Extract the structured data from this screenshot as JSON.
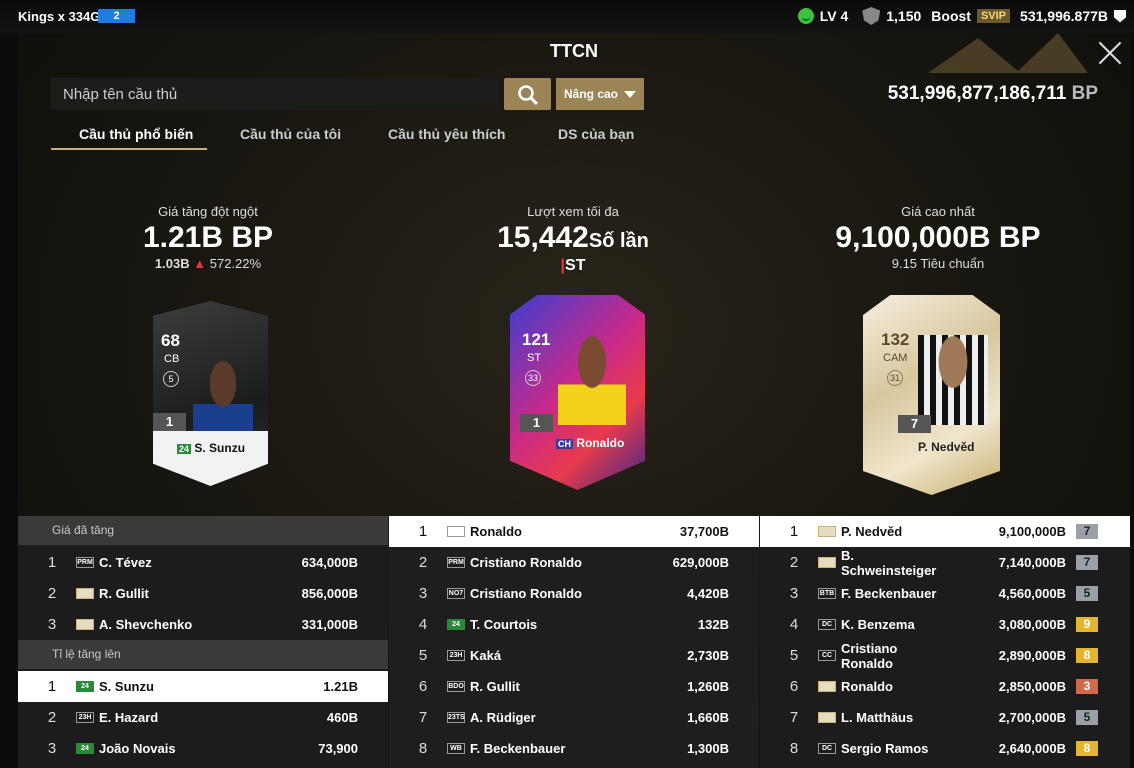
{
  "topbar": {
    "user": "Kings x 334G",
    "badge": "2",
    "level": "LV 4",
    "shield": "1,150",
    "boost": "Boost",
    "svip": "SVIP",
    "bp": "531,996.877B"
  },
  "title": "TTCN",
  "search": {
    "placeholder": "Nhập tên cầu thủ",
    "advanced": "Nâng cao"
  },
  "balance": {
    "value": "531,996,877,186,711",
    "unit": "BP"
  },
  "tabs": [
    "Cầu thủ phổ biến",
    "Cầu thủ của tôi",
    "Cầu thủ yêu thích",
    "DS của bạn"
  ],
  "featured": [
    {
      "label": "Giá tăng đột ngột",
      "big": "1.21B BP",
      "sub_a": "1.03B",
      "sub_b": "572.22%",
      "card": {
        "ovr": "68",
        "pos": "CB",
        "tier": "5",
        "lvl": "1",
        "season": "24",
        "name": "S. Sunzu"
      }
    },
    {
      "label": "Lượt xem tối đa",
      "big": "15,442",
      "big_unit": "Số lần",
      "pos": "ST",
      "card": {
        "ovr": "121",
        "pos": "ST",
        "tier": "33",
        "lvl": "1",
        "season": "CH",
        "name": "Ronaldo"
      }
    },
    {
      "label": "Giá cao nhất",
      "big": "9,100,000B BP",
      "sub": "9.15 Tiêu chuẩn",
      "card": {
        "ovr": "132",
        "pos": "CAM",
        "tier": "31",
        "lvl": "7",
        "season": "",
        "name": "P. Nedvěd"
      }
    }
  ],
  "left": {
    "header1": "Giá đã tăng",
    "rows1": [
      {
        "rank": "1",
        "season": "PRM",
        "name": "C. Tévez",
        "value": "634,000B"
      },
      {
        "rank": "2",
        "season": "",
        "name": "R. Gullit",
        "value": "856,000B"
      },
      {
        "rank": "3",
        "season": "",
        "name": "A. Shevchenko",
        "value": "331,000B"
      }
    ],
    "header2": "Tỉ lệ tăng lên",
    "rows2": [
      {
        "rank": "1",
        "season": "24",
        "name": "S. Sunzu",
        "value": "1.21B"
      },
      {
        "rank": "2",
        "season": "23H",
        "name": "E. Hazard",
        "value": "460B"
      },
      {
        "rank": "3",
        "season": "24",
        "name": "João Novais",
        "value": "73,900"
      }
    ]
  },
  "middle": [
    {
      "rank": "1",
      "season": "CH",
      "name": "Ronaldo",
      "value": "37,700B"
    },
    {
      "rank": "2",
      "season": "PRM",
      "name": "Cristiano Ronaldo",
      "value": "629,000B"
    },
    {
      "rank": "3",
      "season": "NO7",
      "name": "Cristiano Ronaldo",
      "value": "4,420B"
    },
    {
      "rank": "4",
      "season": "24",
      "name": "T. Courtois",
      "value": "132B"
    },
    {
      "rank": "5",
      "season": "23H",
      "name": "Kaká",
      "value": "2,730B"
    },
    {
      "rank": "6",
      "season": "BDO",
      "name": "R. Gullit",
      "value": "1,260B"
    },
    {
      "rank": "7",
      "season": "23TS",
      "name": "A. Rüdiger",
      "value": "1,660B"
    },
    {
      "rank": "8",
      "season": "WB",
      "name": "F. Beckenbauer",
      "value": "1,300B"
    }
  ],
  "right": [
    {
      "rank": "1",
      "season": "",
      "name": "P. Nedvěd",
      "value": "9,100,000B",
      "lvl": "7"
    },
    {
      "rank": "2",
      "season": "",
      "name": "B. Schweinsteiger",
      "value": "7,140,000B",
      "lvl": "7"
    },
    {
      "rank": "3",
      "season": "BTB",
      "name": "F. Beckenbauer",
      "value": "4,560,000B",
      "lvl": "5"
    },
    {
      "rank": "4",
      "season": "DC",
      "name": "K. Benzema",
      "value": "3,080,000B",
      "lvl": "9"
    },
    {
      "rank": "5",
      "season": "CC",
      "name": "Cristiano Ronaldo",
      "value": "2,890,000B",
      "lvl": "8"
    },
    {
      "rank": "6",
      "season": "",
      "name": "Ronaldo",
      "value": "2,850,000B",
      "lvl": "3"
    },
    {
      "rank": "7",
      "season": "",
      "name": "L. Matthäus",
      "value": "2,700,000B",
      "lvl": "5"
    },
    {
      "rank": "8",
      "season": "DC",
      "name": "Sergio Ramos",
      "value": "2,640,000B",
      "lvl": "8"
    }
  ],
  "colors": {
    "accent": "#9b8456",
    "gold": "#c9b07a",
    "up": "#e23a3a"
  }
}
